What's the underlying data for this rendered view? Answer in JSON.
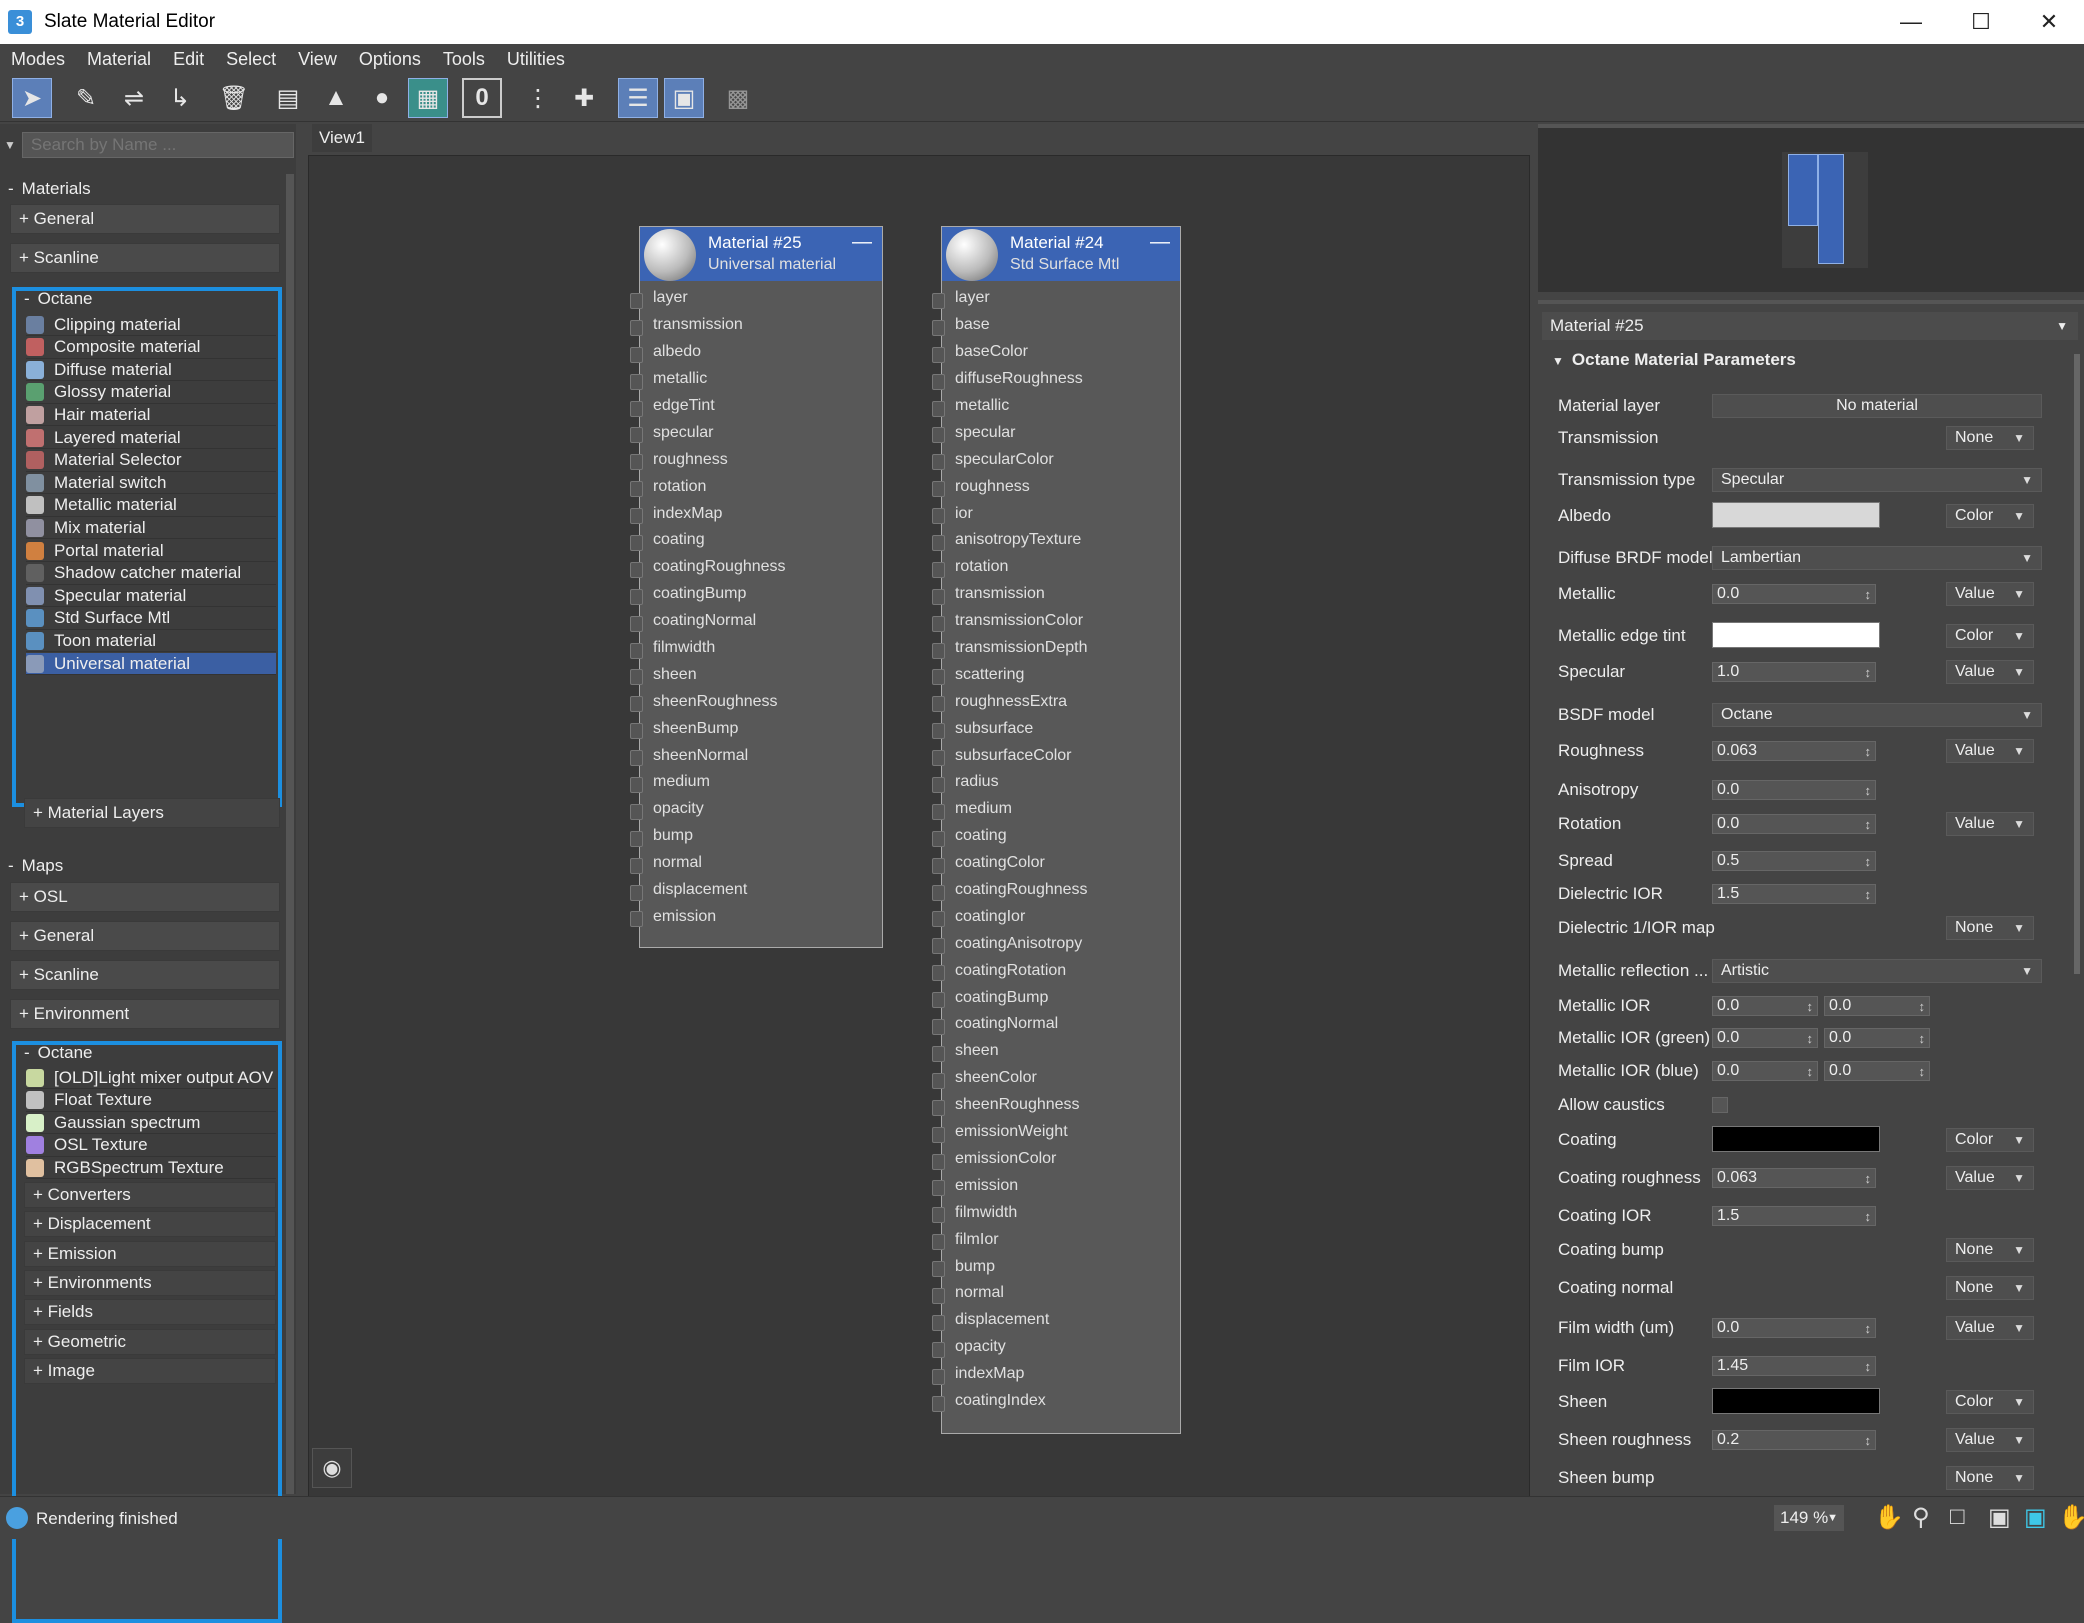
{
  "window": {
    "title": "Slate Material Editor",
    "app_icon": "3"
  },
  "menu": [
    "Modes",
    "Material",
    "Edit",
    "Select",
    "View",
    "Options",
    "Tools",
    "Utilities"
  ],
  "search": {
    "placeholder": "Search by Name ..."
  },
  "browser": {
    "materials_header": "Materials",
    "materials_general": "+ General",
    "materials_scanline": "+ Scanline",
    "materials_octane": "Octane",
    "materials_items": [
      "Clipping material",
      "Composite material",
      "Diffuse material",
      "Glossy material",
      "Hair material",
      "Layered material",
      "Material Selector",
      "Material switch",
      "Metallic material",
      "Mix material",
      "Portal material",
      "Shadow catcher material",
      "Specular material",
      "Std Surface Mtl",
      "Toon material",
      "Universal material"
    ],
    "selected_item": "Universal material",
    "material_layers": "+ Material Layers",
    "maps_header": "Maps",
    "maps_cats": [
      "+ OSL",
      "+ General",
      "+ Scanline",
      "+ Environment"
    ],
    "maps_octane": "Octane",
    "maps_items": [
      "[OLD]Light mixer output AOV",
      "Float Texture",
      "Gaussian spectrum",
      "OSL Texture",
      "RGBSpectrum Texture"
    ],
    "maps_sub": [
      "+ Converters",
      "+ Displacement",
      "+ Emission",
      "+ Environments",
      "+ Fields",
      "+ Geometric",
      "+ Image"
    ]
  },
  "view_tab": "View1",
  "nodes": [
    {
      "name": "Material #25",
      "type": "Universal material",
      "slots": [
        "layer",
        "transmission",
        "albedo",
        "metallic",
        "edgeTint",
        "specular",
        "roughness",
        "rotation",
        "indexMap",
        "coating",
        "coatingRoughness",
        "coatingBump",
        "coatingNormal",
        "filmwidth",
        "sheen",
        "sheenRoughness",
        "sheenBump",
        "sheenNormal",
        "medium",
        "opacity",
        "bump",
        "normal",
        "displacement",
        "emission"
      ]
    },
    {
      "name": "Material #24",
      "type": "Std Surface Mtl",
      "slots": [
        "layer",
        "base",
        "baseColor",
        "diffuseRoughness",
        "metallic",
        "specular",
        "specularColor",
        "roughness",
        "ior",
        "anisotropyTexture",
        "rotation",
        "transmission",
        "transmissionColor",
        "transmissionDepth",
        "scattering",
        "roughnessExtra",
        "subsurface",
        "subsurfaceColor",
        "radius",
        "medium",
        "coating",
        "coatingColor",
        "coatingRoughness",
        "coatingIor",
        "coatingAnisotropy",
        "coatingRotation",
        "coatingBump",
        "coatingNormal",
        "sheen",
        "sheenColor",
        "sheenRoughness",
        "emissionWeight",
        "emissionColor",
        "emission",
        "filmwidth",
        "filmIor",
        "bump",
        "normal",
        "displacement",
        "opacity",
        "indexMap",
        "coatingIndex"
      ]
    }
  ],
  "properties": {
    "material_select": "Material #25",
    "rollout_title": "Octane Material Parameters",
    "rows": [
      {
        "label": "Material layer",
        "kind": "button",
        "value": "No material"
      },
      {
        "label": "Transmission",
        "mode": "None"
      },
      {
        "label": "Transmission type",
        "kind": "dropdown",
        "value": "Specular"
      },
      {
        "label": "Albedo",
        "kind": "color",
        "color": "#d8d8d8",
        "mode": "Color"
      },
      {
        "label": "Diffuse BRDF model",
        "kind": "dropdown",
        "value": "Lambertian"
      },
      {
        "label": "Metallic",
        "kind": "spin",
        "value": "0.0",
        "mode": "Value"
      },
      {
        "label": "Metallic edge tint",
        "kind": "color",
        "color": "#ffffff",
        "mode": "Color"
      },
      {
        "label": "Specular",
        "kind": "spin",
        "value": "1.0",
        "mode": "Value"
      },
      {
        "label": "BSDF model",
        "kind": "dropdown",
        "value": "Octane"
      },
      {
        "label": "Roughness",
        "kind": "spin",
        "value": "0.063",
        "mode": "Value"
      },
      {
        "label": "Anisotropy",
        "kind": "spin",
        "value": "0.0"
      },
      {
        "label": "Rotation",
        "kind": "spin",
        "value": "0.0",
        "mode": "Value"
      },
      {
        "label": "Spread",
        "kind": "spin",
        "value": "0.5"
      },
      {
        "label": "Dielectric IOR",
        "kind": "spin",
        "value": "1.5"
      },
      {
        "label": "Dielectric 1/IOR map",
        "mode": "None"
      },
      {
        "label": "Metallic reflection ...",
        "kind": "dropdown",
        "value": "Artistic"
      },
      {
        "label": "Metallic IOR",
        "kind": "spin2",
        "value": "0.0",
        "value2": "0.0"
      },
      {
        "label": "Metallic IOR (green)",
        "kind": "spin2",
        "value": "0.0",
        "value2": "0.0"
      },
      {
        "label": "Metallic IOR (blue)",
        "kind": "spin2",
        "value": "0.0",
        "value2": "0.0"
      },
      {
        "label": "Allow caustics",
        "kind": "check"
      },
      {
        "label": "Coating",
        "kind": "color",
        "color": "#000000",
        "mode": "Color"
      },
      {
        "label": "Coating roughness",
        "kind": "spin",
        "value": "0.063",
        "mode": "Value"
      },
      {
        "label": "Coating IOR",
        "kind": "spin",
        "value": "1.5"
      },
      {
        "label": "Coating bump",
        "mode": "None"
      },
      {
        "label": "Coating normal",
        "mode": "None"
      },
      {
        "label": "Film width (um)",
        "kind": "spin",
        "value": "0.0",
        "mode": "Value"
      },
      {
        "label": "Film IOR",
        "kind": "spin",
        "value": "1.45"
      },
      {
        "label": "Sheen",
        "kind": "color",
        "color": "#000000",
        "mode": "Color"
      },
      {
        "label": "Sheen roughness",
        "kind": "spin",
        "value": "0.2",
        "mode": "Value"
      },
      {
        "label": "Sheen bump",
        "mode": "None"
      }
    ]
  },
  "status": {
    "text": "Rendering finished",
    "zoom": "149 %"
  },
  "colors": {
    "accent": "#1c8fe0",
    "node_header": "#3b64b4",
    "selection": "#3b5fa3"
  }
}
